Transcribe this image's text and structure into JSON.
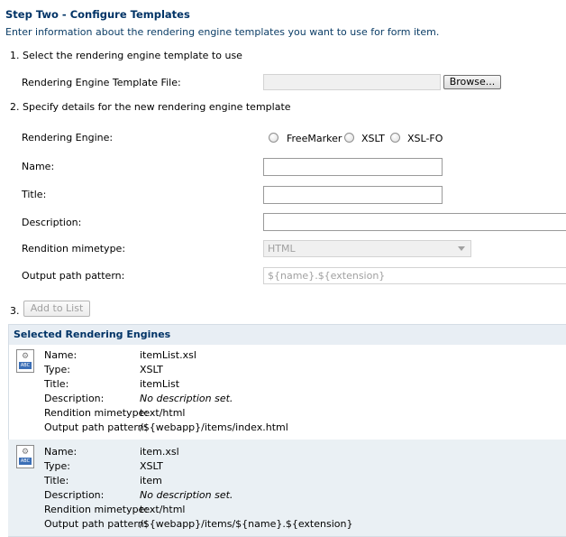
{
  "header": {
    "title": "Step Two - Configure Templates",
    "intro": "Enter information about the rendering engine templates you want to use for form item."
  },
  "step1": {
    "label": "1. Select the rendering engine template to use",
    "file_label": "Rendering Engine Template File:",
    "browse_label": "Browse..."
  },
  "step2": {
    "label": "2. Specify details for the new rendering engine template",
    "engine_label": "Rendering Engine:",
    "engines": [
      "FreeMarker",
      "XSLT",
      "XSL-FO"
    ],
    "name_label": "Name:",
    "title_label": "Title:",
    "description_label": "Description:",
    "mimetype_label": "Rendition mimetype:",
    "mimetype_value": "HTML",
    "output_label": "Output path pattern:",
    "output_placeholder": "${name}.${extension}"
  },
  "step3": {
    "number": "3.",
    "add_label": "Add to List"
  },
  "selected": {
    "heading": "Selected Rendering Engines",
    "field_labels": {
      "name": "Name:",
      "type": "Type:",
      "title": "Title:",
      "description": "Description:",
      "mimetype": "Rendition mimetype:",
      "output": "Output path pattern:"
    },
    "entries": [
      {
        "name": "itemList.xsl",
        "type": "XSLT",
        "title": "itemList",
        "description": "No description set.",
        "mimetype": "text/html",
        "output": "/${webapp}/items/index.html"
      },
      {
        "name": "item.xsl",
        "type": "XSLT",
        "title": "item",
        "description": "No description set.",
        "mimetype": "text/html",
        "output": "/${webapp}/items/${name}.${extension}"
      }
    ],
    "icon_badge": "ABC"
  }
}
